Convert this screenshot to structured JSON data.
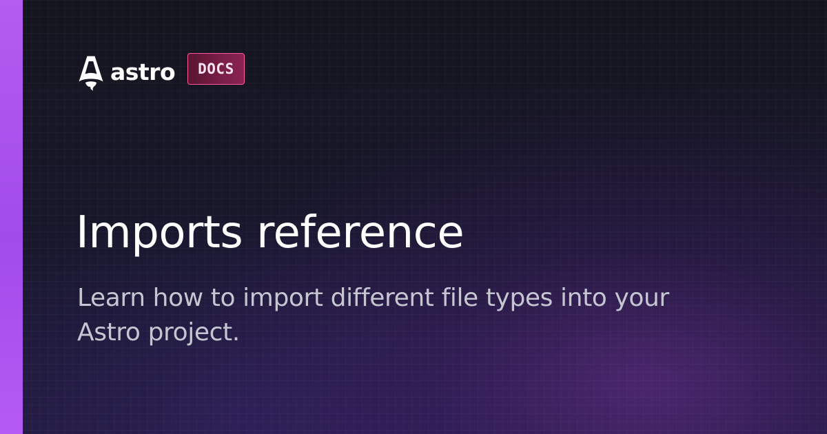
{
  "brand": {
    "name": "astro",
    "badge": "DOCS",
    "logo_icon": "astro-rocket-icon"
  },
  "page": {
    "title": "Imports reference",
    "description": "Learn how to import different file types into your Astro project."
  },
  "colors": {
    "accent_stripe": "#a855f7",
    "background": "#14141f",
    "badge_border": "#ff5a9e",
    "badge_fill": "#7a1f48",
    "title": "#ffffff",
    "description": "#c5c6d2"
  }
}
